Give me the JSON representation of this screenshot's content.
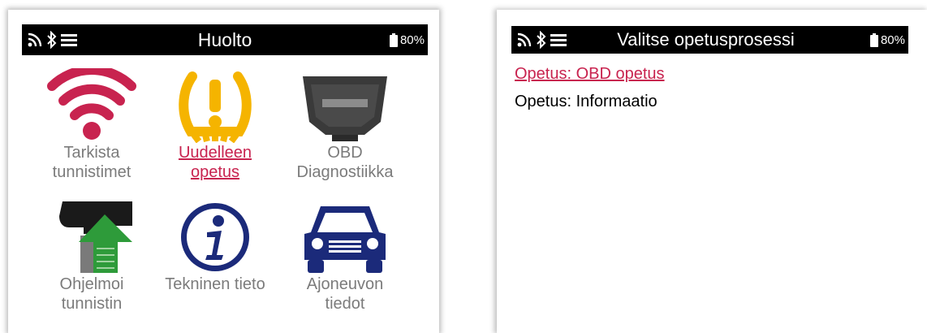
{
  "left_screen": {
    "title": "Huolto",
    "battery": "80%",
    "tiles": [
      {
        "label": "Tarkista\ntunnistimet",
        "icon": "wifi-icon",
        "color": "#c8234f",
        "active": false
      },
      {
        "label": "Uudelleen\nopetus",
        "icon": "tpms-warning-icon",
        "color": "#f5b400",
        "active": true
      },
      {
        "label": "OBD\nDiagnostiikka",
        "icon": "obd-connector-icon",
        "color": "#444444",
        "active": false
      },
      {
        "label": "Ohjelmoi\ntunnistin",
        "icon": "program-sensor-icon",
        "color": "#2e9b3a",
        "active": false
      },
      {
        "label": "Tekninen tieto",
        "icon": "info-icon",
        "color": "#1b2a7a",
        "active": false
      },
      {
        "label": "Ajoneuvon\ntiedot",
        "icon": "car-icon",
        "color": "#1b2a7a",
        "active": false
      }
    ]
  },
  "right_screen": {
    "title": "Valitse opetusprosessi",
    "battery": "80%",
    "menu": [
      {
        "label": "Opetus: OBD opetus",
        "selected": true
      },
      {
        "label": "Opetus: Informaatio",
        "selected": false
      }
    ]
  },
  "colors": {
    "accent": "#c8234f",
    "statusbar": "#000000",
    "inactive_text": "#7b7b7b"
  }
}
